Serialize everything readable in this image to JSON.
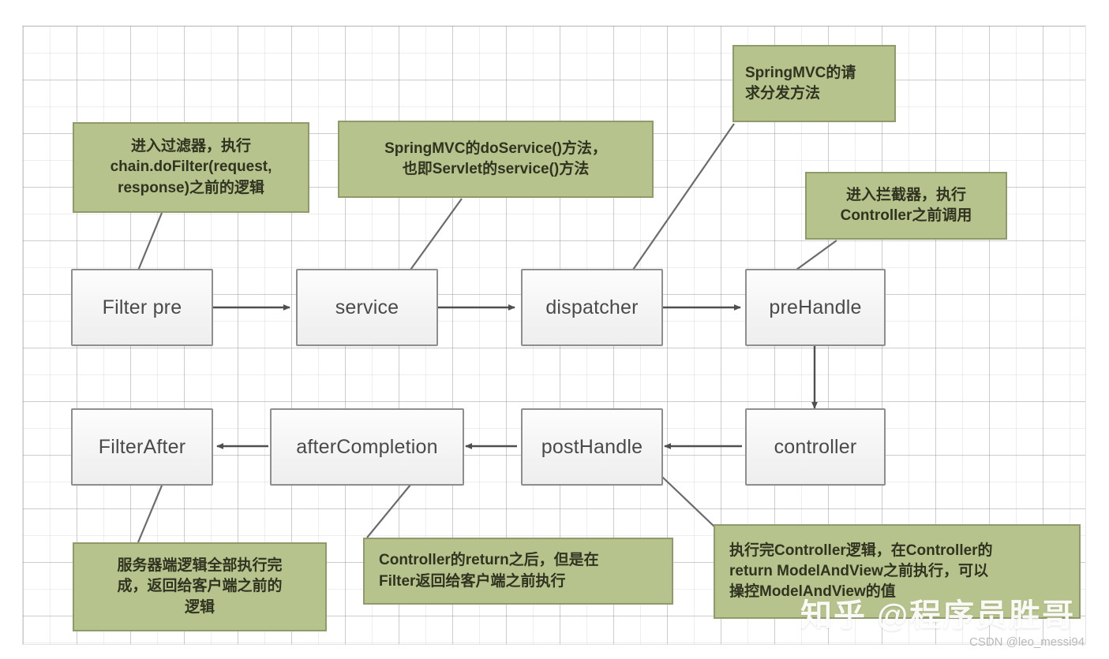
{
  "diagram": {
    "title": "SpringMVC request lifecycle flow",
    "colors": {
      "note_fill": "#b7c38c",
      "note_border": "#8f9a6b",
      "node_border": "#8e8e8e",
      "node_fill": "#f4f4f4",
      "connector": "#6b6b6b",
      "grid": "#d6d6d6"
    },
    "nodes": [
      {
        "id": "filter-pre",
        "label": "Filter pre"
      },
      {
        "id": "service",
        "label": "service"
      },
      {
        "id": "dispatcher",
        "label": "dispatcher"
      },
      {
        "id": "prehandle",
        "label": "preHandle"
      },
      {
        "id": "controller",
        "label": "controller"
      },
      {
        "id": "posthandle",
        "label": "postHandle"
      },
      {
        "id": "aftercompletion",
        "label": "afterCompletion"
      },
      {
        "id": "filter-after",
        "label": "FilterAfter"
      }
    ],
    "notes": [
      {
        "id": "note-filter-pre",
        "lines": [
          "进入过滤器，执行",
          "chain.doFilter(request,",
          "response)之前的逻辑"
        ]
      },
      {
        "id": "note-service",
        "lines": [
          "SpringMVC的doService()方法，",
          "也即Servlet的service()方法"
        ]
      },
      {
        "id": "note-dispatcher",
        "lines": [
          "SpringMVC的请",
          "求分发方法"
        ]
      },
      {
        "id": "note-prehandle",
        "lines": [
          "进入拦截器，执行",
          "Controller之前调用"
        ]
      },
      {
        "id": "note-filter-after",
        "lines": [
          "服务器端逻辑全部执行完",
          "成，返回给客户端之前的",
          "逻辑"
        ]
      },
      {
        "id": "note-aftercompletion",
        "lines": [
          "Controller的return之后，但是在",
          "Filter返回给客户端之前执行"
        ]
      },
      {
        "id": "note-posthandle",
        "lines": [
          "执行完Controller逻辑，在Controller的",
          "return ModelAndView之前执行，可以",
          "操控ModelAndView的值"
        ]
      }
    ],
    "edges": [
      {
        "from": "filter-pre",
        "to": "service",
        "direction": "right"
      },
      {
        "from": "service",
        "to": "dispatcher",
        "direction": "right"
      },
      {
        "from": "dispatcher",
        "to": "prehandle",
        "direction": "right"
      },
      {
        "from": "prehandle",
        "to": "controller",
        "direction": "down"
      },
      {
        "from": "controller",
        "to": "posthandle",
        "direction": "left"
      },
      {
        "from": "posthandle",
        "to": "aftercompletion",
        "direction": "left"
      },
      {
        "from": "aftercompletion",
        "to": "filter-after",
        "direction": "left"
      }
    ]
  },
  "watermarks": {
    "zhihu": "知乎 @程序员胜哥",
    "csdn": "CSDN @leo_messi94"
  }
}
